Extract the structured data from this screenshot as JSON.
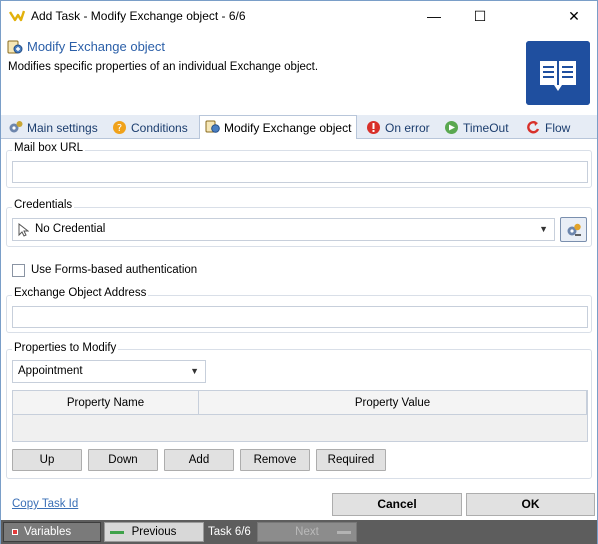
{
  "window": {
    "title": "Add Task - Modify Exchange object - 6/6",
    "minimize_glyph": "—",
    "maximize_glyph": "☐",
    "close_glyph": "✕"
  },
  "header": {
    "title": "Modify Exchange object",
    "description": "Modifies specific properties of an individual Exchange object."
  },
  "tabs": [
    {
      "label": "Main settings",
      "icon": "gears-icon"
    },
    {
      "label": "Conditions",
      "icon": "question-icon"
    },
    {
      "label": "Modify Exchange object",
      "icon": "exchange-icon",
      "active": true
    },
    {
      "label": "On error",
      "icon": "error-icon"
    },
    {
      "label": "TimeOut",
      "icon": "timeout-icon"
    },
    {
      "label": "Flow",
      "icon": "flow-icon"
    }
  ],
  "main": {
    "mailbox_url": {
      "label": "Mail box URL",
      "value": ""
    },
    "credentials": {
      "label": "Credentials",
      "selected": "No Credential"
    },
    "forms_auth": {
      "label": "Use Forms-based authentication",
      "checked": false
    },
    "object_address": {
      "label": "Exchange Object Address",
      "value": ""
    },
    "properties": {
      "label": "Properties to Modify",
      "selected": "Appointment",
      "columns": [
        "Property Name",
        "Property Value"
      ],
      "rows": []
    },
    "buttons": {
      "up": "Up",
      "down": "Down",
      "add": "Add",
      "remove": "Remove",
      "required": "Required"
    }
  },
  "footer": {
    "copy_link": "Copy Task Id",
    "cancel": "Cancel",
    "ok": "OK"
  },
  "statusbar": {
    "variables": "Variables",
    "previous": "Previous",
    "task": "Task 6/6",
    "next": "Next"
  },
  "colors": {
    "accent": "#2b5fa8",
    "logo_bg": "#1f4f9f",
    "statusbar_bg": "#5d5d5d"
  }
}
